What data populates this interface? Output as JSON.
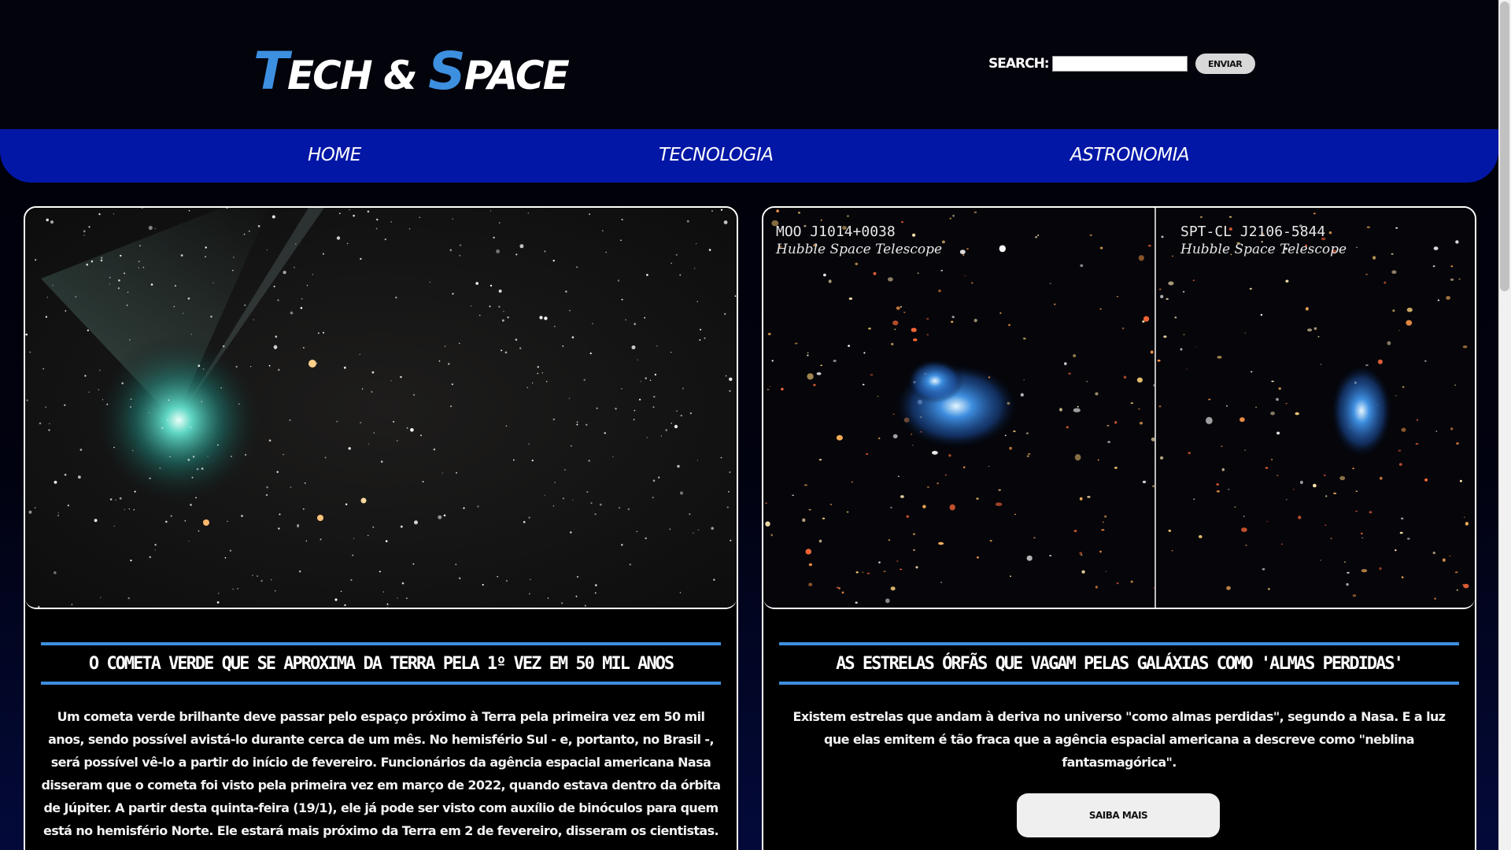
{
  "header": {
    "logo": {
      "first_initial": "T",
      "first_rest": "ECH & ",
      "second_initial": "S",
      "second_rest": "PACE"
    },
    "search": {
      "label": "SEARCH:",
      "value": "",
      "button_label": "ENVIAR"
    }
  },
  "nav": {
    "items": [
      {
        "label": "HOME"
      },
      {
        "label": "TECNOLOGIA"
      },
      {
        "label": "ASTRONOMIA"
      }
    ]
  },
  "articles": [
    {
      "image_alt": "comet-image",
      "title": "O COMETA VERDE QUE SE APROXIMA DA TERRA PELA 1º VEZ EM 50 MIL ANOS",
      "body": "Um cometa verde brilhante deve passar pelo espaço próximo à Terra pela primeira vez em 50 mil anos, sendo possível avistá-lo durante cerca de um mês. No hemisfério Sul - e, portanto, no Brasil -, será possível vê-lo a partir do início de fevereiro. Funcionários da agência espacial americana Nasa disseram que o cometa foi visto pela primeira vez em março de 2022, quando estava dentro da órbita de Júpiter. A partir desta quinta-feira (19/1), ele já pode ser visto com auxílio de binóculos para quem está no hemisfério Norte. Ele estará mais próximo da Terra em 2 de fevereiro, disseram os cientistas."
    },
    {
      "image_alt": "galaxy-clusters-image",
      "panels": [
        {
          "name": "MOO J1014+0038",
          "telescope": "Hubble Space Telescope"
        },
        {
          "name": "SPT-CL J2106-5844",
          "telescope": "Hubble Space Telescope"
        }
      ],
      "title": "AS ESTRELAS ÓRFÃS QUE VAGAM PELAS GALÁXIAS COMO 'ALMAS PERDIDAS'",
      "body": "Existem estrelas que andam à deriva no universo \"como almas perdidas\", segundo a Nasa. E a luz que elas emitem é tão fraca que a agência espacial americana a descreve como \"neblina fantasmagórica\".",
      "button_label": "SAIBA MAIS"
    }
  ],
  "colors": {
    "accent": "#3d8fe0",
    "nav_bg": "#0317a6",
    "page_bg": "#000008"
  }
}
